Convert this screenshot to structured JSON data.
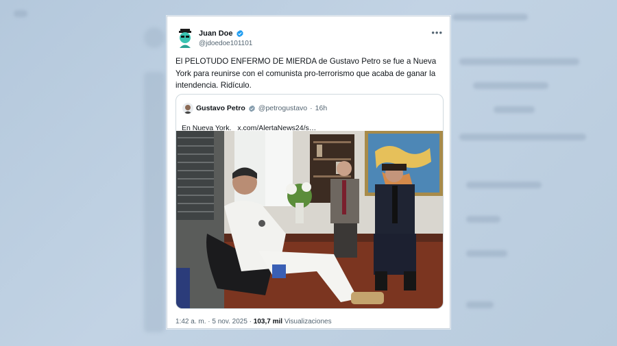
{
  "tweet": {
    "author_name": "Juan Doe",
    "author_handle": "@jdoedoe101101",
    "text": "El PELOTUDO ENFERMO DE MIERDA de Gustavo Petro se fue a Nueva York para reunirse con el comunista pro-terrorismo que acaba de ganar la intendencia. Ridículo.",
    "time": "1:42 a. m.",
    "date": "5 nov. 2025",
    "views_count": "103,7 mil",
    "views_label": "Visualizaciones",
    "more_icon": "more-horizontal-icon",
    "verified_color": "#1d9bf0"
  },
  "quote": {
    "author_name": "Gustavo Petro",
    "author_handle": "@petrogustavo",
    "time_ago": "16h",
    "text": "En Nueva York.",
    "link": "x.com/AlertaNews24/s…",
    "verified_color": "#829aab"
  }
}
